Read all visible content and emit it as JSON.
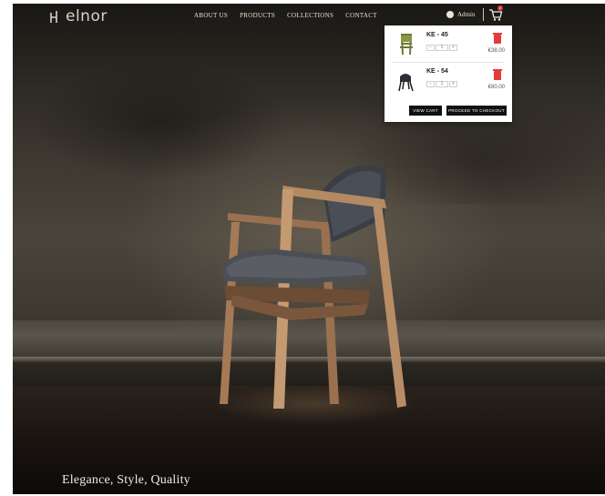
{
  "brand": {
    "logo_text": "elnor"
  },
  "nav": {
    "items": [
      "ABOUT US",
      "PRODUCTS",
      "COLLECTIONS",
      "CONTACT"
    ]
  },
  "user": {
    "name": "Admin"
  },
  "cart": {
    "badge_count": "2",
    "items": [
      {
        "name": "KE - 45",
        "qty": "1",
        "minus": "−",
        "plus": "+",
        "price": "€38.00",
        "thumb_color": "#7d8a3a"
      },
      {
        "name": "KE - 54",
        "qty": "1",
        "minus": "−",
        "plus": "+",
        "price": "€60.00",
        "thumb_color": "#2a2f36"
      }
    ],
    "view_cart_label": "VIEW CART",
    "checkout_label": "PROCEED TO CHECKOUT"
  },
  "hero": {
    "tagline": "Elegance, Style, Quality"
  },
  "colors": {
    "delete": "#e23b3b",
    "button_bg": "#111111",
    "badge": "#d93838"
  }
}
